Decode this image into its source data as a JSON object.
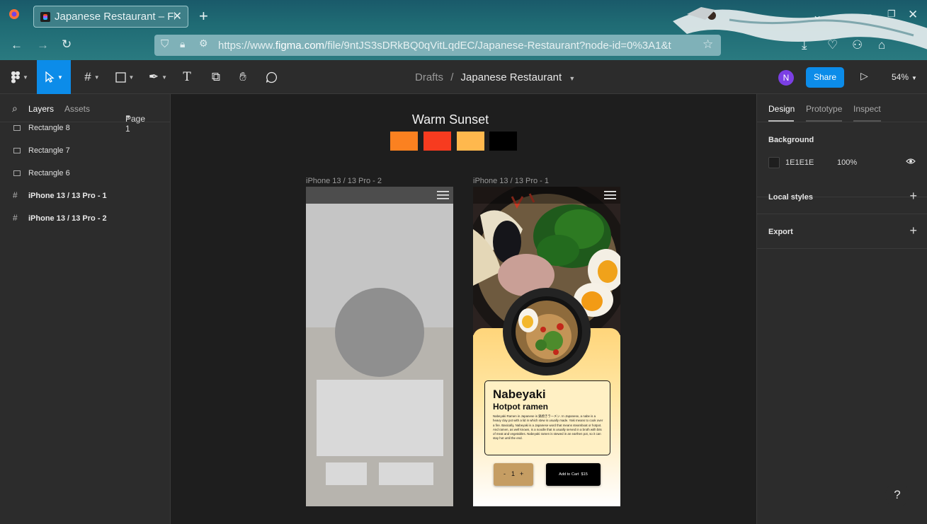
{
  "browser": {
    "tab_title": "Japanese Restaurant – Fi",
    "url_prefix": "https://www.",
    "url_domain": "figma.com",
    "url_rest": "/file/9ntJS3sDRkBQ0qVitLqdEC/Japanese-Restaurant?node-id=0%3A1&t"
  },
  "toolbar": {
    "crumb_parent": "Drafts",
    "crumb_sep": "/",
    "crumb_file": "Japanese Restaurant",
    "avatar_initial": "N",
    "share_label": "Share",
    "zoom": "54%"
  },
  "left_panel": {
    "tab_layers": "Layers",
    "tab_assets": "Assets",
    "page": "Page 1",
    "layers": [
      {
        "name": "Rectangle 8",
        "kind": "rect"
      },
      {
        "name": "Rectangle 7",
        "kind": "rect"
      },
      {
        "name": "Rectangle 6",
        "kind": "rect"
      },
      {
        "name": "iPhone 13 / 13 Pro - 1",
        "kind": "frame"
      },
      {
        "name": "iPhone 13 / 13 Pro - 2",
        "kind": "frame"
      }
    ]
  },
  "right_panel": {
    "tab_design": "Design",
    "tab_prototype": "Prototype",
    "tab_inspect": "Inspect",
    "background_label": "Background",
    "background_hex": "1E1E1E",
    "background_opacity": "100%",
    "local_styles": "Local styles",
    "export": "Export"
  },
  "canvas": {
    "palette_title": "Warm Sunset",
    "palette": [
      "#fb8120",
      "#f73b1f",
      "#ffb84d",
      "#000000"
    ],
    "frame2_label": "iPhone 13 / 13 Pro - 2",
    "frame1_label": "iPhone 13 / 13 Pro - 1",
    "dish_name": "Nabeyaki",
    "dish_sub": "Hotpot ramen",
    "dish_desc": "Nabeyaki Ramen in Japanese is 鍋焼きラーメン. In Japanese, a nabe is a heavy clay pot with a lid in which stew is usually made. Yaki means to cook over a fire. Basically, Nabeyaki is a Japanese word that means steamboat or hotpot. And ramen, as well known, is a noodle that is usually served in a broth with bits of meat and vegetables. Nabeyaki ramen is stewed in an earthen pot, so it can stay hot until the end.",
    "qty_minus": "-",
    "qty_value": "1",
    "qty_plus": "+",
    "cart_label": "Add to Cart",
    "cart_price": "$15"
  },
  "help_label": "?"
}
